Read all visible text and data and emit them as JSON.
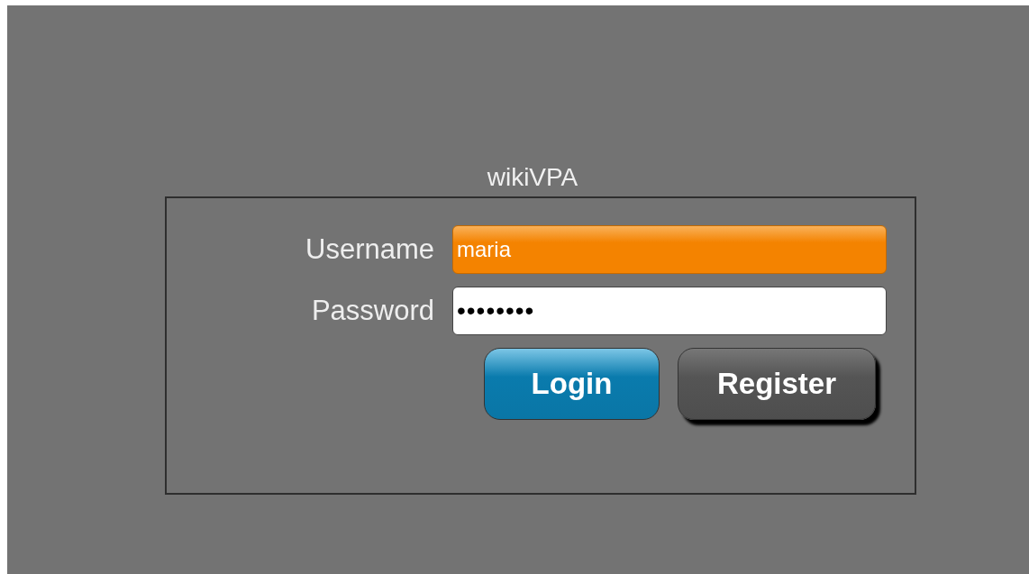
{
  "title": "wikiVPA",
  "username": {
    "label": "Username",
    "value": "maria",
    "focused": true
  },
  "password": {
    "label": "Password",
    "value": "••••••••",
    "focused": false
  },
  "buttons": [
    {
      "label": "Login",
      "kind": "primary"
    },
    {
      "label": "Register",
      "kind": "secondary"
    }
  ]
}
